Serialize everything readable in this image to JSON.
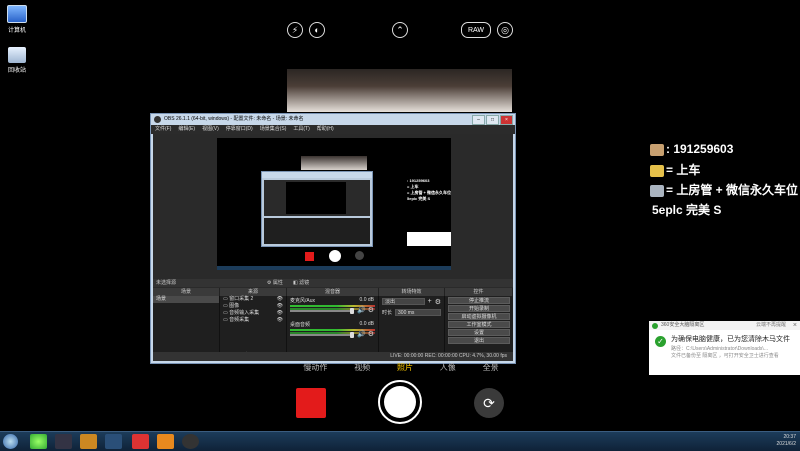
{
  "desktop": {
    "icons": [
      {
        "label": "计算机",
        "icon": "computer-icon"
      },
      {
        "label": "回收站",
        "icon": "recycle-bin-icon"
      }
    ]
  },
  "camera": {
    "top_controls": {
      "flash": "flash-off-icon",
      "hdr": "hdr-icon",
      "expand": "chevron-up-icon",
      "raw_label": "RAW",
      "live": "live-photo-icon"
    },
    "modes": [
      "慢动作",
      "视频",
      "照片",
      "人像",
      "全景"
    ],
    "record_color": "#e31b1b"
  },
  "obs": {
    "title": "OBS 26.1.1 (64-bit, windows) - 配置文件: 未命名 - 场景: 未命名",
    "menu": [
      "文件(F)",
      "编辑(E)",
      "视图(V)",
      "停靠窗口(D)",
      "场景集合(S)",
      "工具(T)",
      "帮助(H)"
    ],
    "scene_strip": "未选择源",
    "strip_tabs": [
      "属性",
      "滤镜"
    ],
    "dock_headers": [
      "场景",
      "来源",
      "混音器",
      "转场特效",
      "控件"
    ],
    "scenes": [
      "场景"
    ],
    "sources": [
      "窗口采集 2",
      "图像",
      "音频输入采集",
      "音频采集"
    ],
    "mixer": [
      {
        "name": "麦克风/Aux",
        "db": "0.0 dB"
      },
      {
        "name": "桌面音频",
        "db": "0.0 dB"
      }
    ],
    "transition": {
      "type": "淡出",
      "duration_label": "时长",
      "duration_value": "300 ms"
    },
    "controls": [
      "停止推流",
      "开始录制",
      "启动虚拟摄像机",
      "工作室模式",
      "设置",
      "退出"
    ],
    "status": "LIVE: 00:00:00   REC: 00:00:00   CPU: 4.7%, 30.00 fps"
  },
  "overlay": {
    "lines": [
      {
        "text": ": 191259603",
        "icon": "avatar-icon"
      },
      {
        "text": "= 上车",
        "icon": "pencil-icon"
      },
      {
        "text": "= 上房管 + 微信永久车位",
        "icon": "keyboard-icon"
      },
      {
        "text": "5eplc 完美 S"
      }
    ]
  },
  "popup": {
    "app": "360安全大脑隔离区",
    "settings_label": "云端不再提醒",
    "message": "为确保电脑健康，已为您清除木马文件",
    "path_line": "路径：C:\\Users\\Administrator\\Downloads\\...",
    "note_line": "文件已备份至 隔离区 ，可打开安全卫士进行查看"
  },
  "taskbar": {
    "time": "20:37",
    "date": "2021/6/2"
  }
}
